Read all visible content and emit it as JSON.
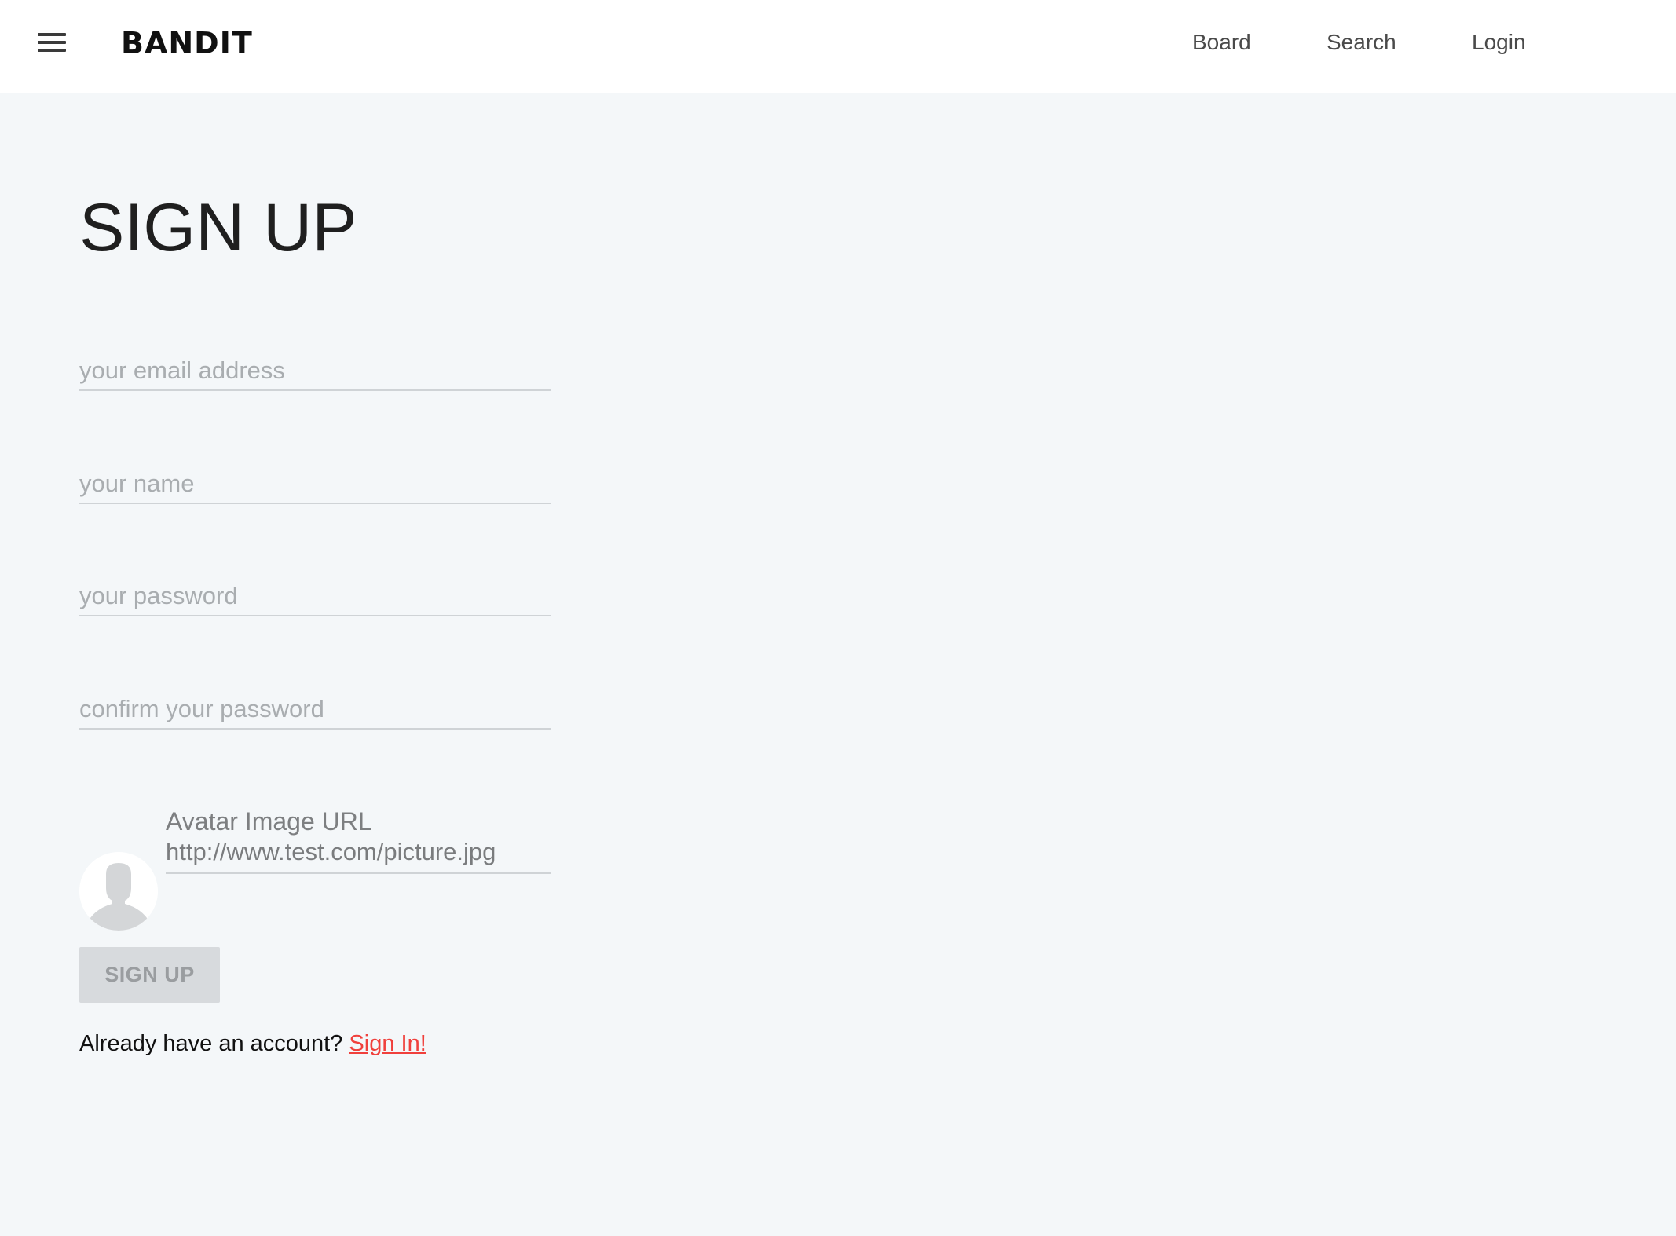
{
  "header": {
    "brand": "BANDIT",
    "nav": {
      "board": "Board",
      "search": "Search",
      "login": "Login"
    }
  },
  "form": {
    "title": "SIGN UP",
    "email_placeholder": "your email address",
    "name_placeholder": "your name",
    "password_placeholder": "your password",
    "confirm_placeholder": "confirm your password",
    "avatar_label": "Avatar Image URL",
    "avatar_url_placeholder": "http://www.test.com/picture.jpg",
    "submit_label": "SIGN UP",
    "signin_prompt": "Already have an account?",
    "signin_link": "Sign In!"
  },
  "colors": {
    "page_background": "#f4f7f9",
    "header_background": "#ffffff",
    "link_accent": "#f0403c",
    "button_disabled_bg": "#d7dadd"
  },
  "icons": [
    "hamburger-menu-icon",
    "avatar-placeholder-icon"
  ]
}
